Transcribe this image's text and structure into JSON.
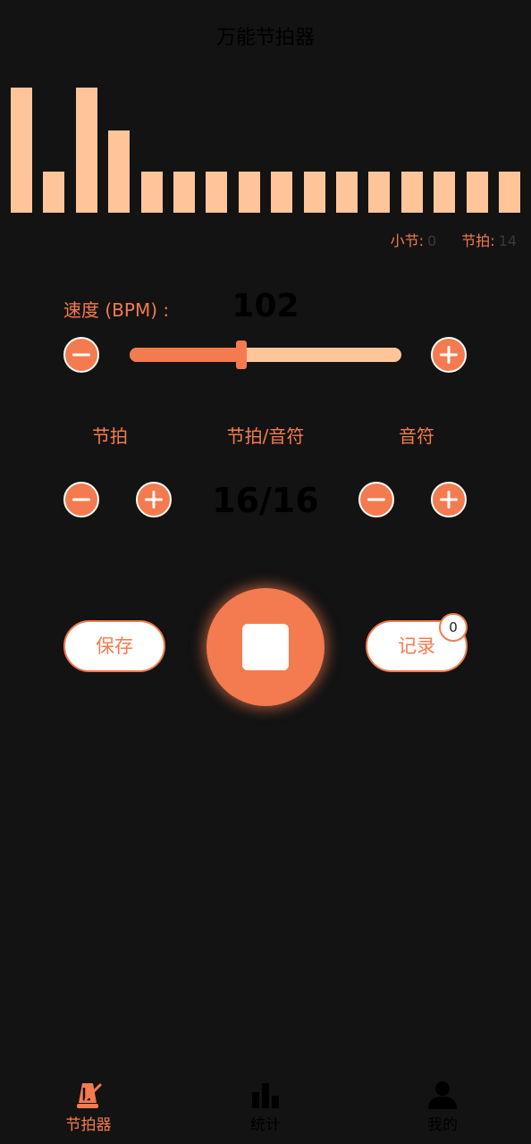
{
  "header": {
    "title": "万能节拍器"
  },
  "visualizer": {
    "accent_color": "#FFC599",
    "bar_levels": [
      1.0,
      0.33,
      1.0,
      0.66,
      0.33,
      0.33,
      0.33,
      0.33,
      0.33,
      0.33,
      0.33,
      0.33,
      0.33,
      0.33,
      0.33,
      0.33
    ]
  },
  "counters": {
    "measure_label": "小节:",
    "measure_value": "0",
    "beat_label": "节拍:",
    "beat_value": "14"
  },
  "tempo": {
    "label": "速度 (BPM) :",
    "value": "102",
    "slider_fraction": 0.41,
    "minus_icon": "minus-icon",
    "plus_icon": "plus-icon"
  },
  "signature": {
    "beats_label": "节拍",
    "signature_label": "节拍/音符",
    "note_label": "音符",
    "value": "16/16"
  },
  "actions": {
    "save_label": "保存",
    "record_label": "记录",
    "record_count": "0",
    "play_state_icon": "stop-icon"
  },
  "nav": {
    "items": [
      {
        "label": "节拍器",
        "icon": "metronome-icon",
        "active": true
      },
      {
        "label": "统计",
        "icon": "bar-chart-icon",
        "active": false
      },
      {
        "label": "我的",
        "icon": "user-icon",
        "active": false
      }
    ]
  },
  "colors": {
    "accent": "#F47B4F",
    "accent_light": "#FFC599",
    "background": "#131313"
  }
}
